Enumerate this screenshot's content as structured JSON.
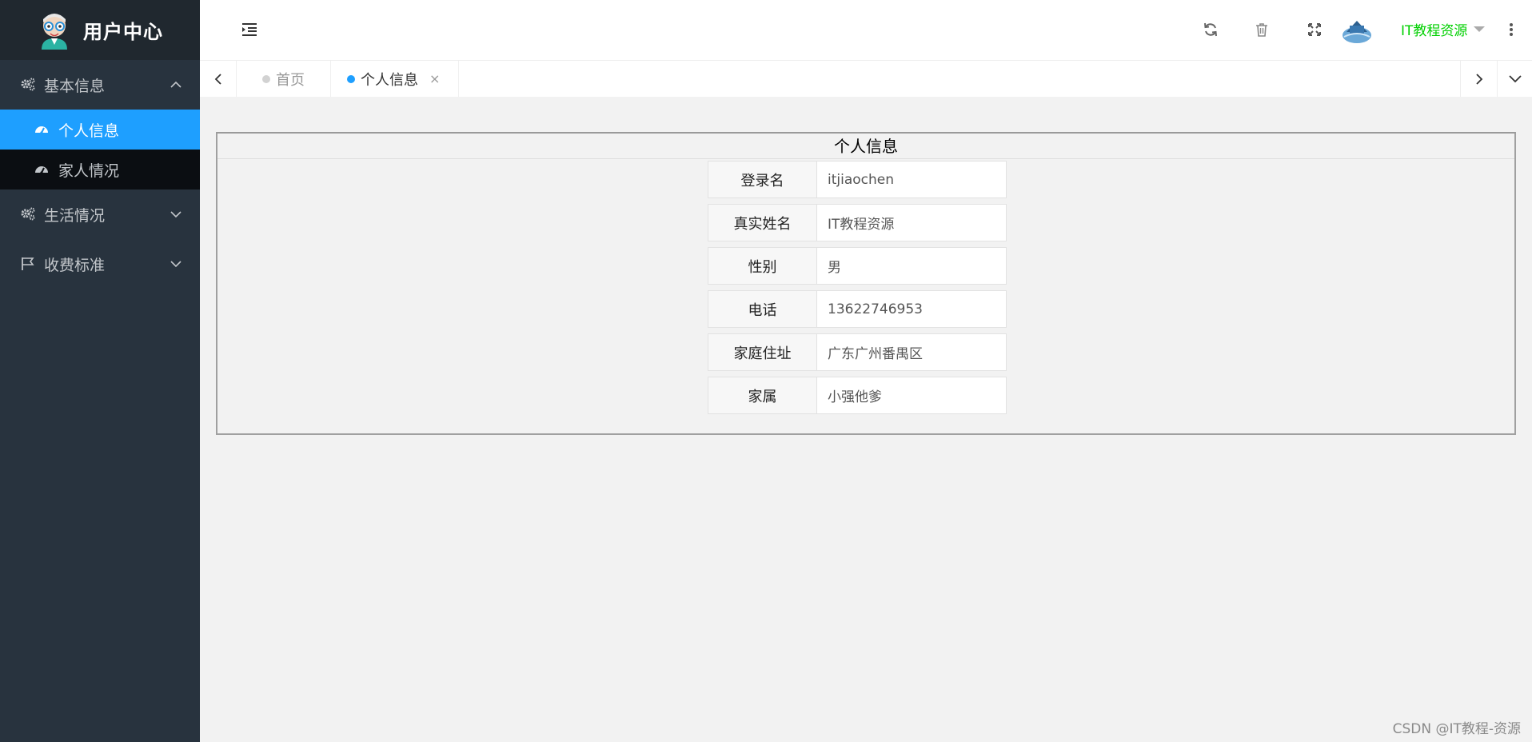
{
  "app": {
    "title": "用户中心"
  },
  "sidebar": {
    "groups": [
      {
        "label": "基本信息",
        "expanded": true,
        "icon": "gears-icon",
        "items": [
          {
            "label": "个人信息",
            "active": true
          },
          {
            "label": "家人情况",
            "active": false
          }
        ]
      },
      {
        "label": "生活情况",
        "expanded": false,
        "icon": "gears-icon"
      },
      {
        "label": "收费标准",
        "expanded": false,
        "icon": "flag-icon"
      }
    ]
  },
  "header": {
    "user_name": "IT教程资源",
    "icons": [
      "refresh-icon",
      "trash-icon",
      "fullscreen-icon",
      "more-vertical-icon"
    ]
  },
  "tabs": [
    {
      "label": "首页",
      "active": false
    },
    {
      "label": "个人信息",
      "active": true,
      "closable": true,
      "close_glyph": "×"
    }
  ],
  "main": {
    "panel_title": "个人信息",
    "rows": [
      {
        "key": "登录名",
        "value": "itjiaochen"
      },
      {
        "key": "真实姓名",
        "value": "IT教程资源"
      },
      {
        "key": "性别",
        "value": "男"
      },
      {
        "key": "电话",
        "value": "13622746953"
      },
      {
        "key": "家庭住址",
        "value": "广东广州番禺区"
      },
      {
        "key": "家属",
        "value": "小强他爹"
      }
    ]
  },
  "watermark": "CSDN @IT教程-资源",
  "colors": {
    "accent": "#1e9fff",
    "sidebar_bg": "#28333e",
    "user_name": "#00d000"
  }
}
